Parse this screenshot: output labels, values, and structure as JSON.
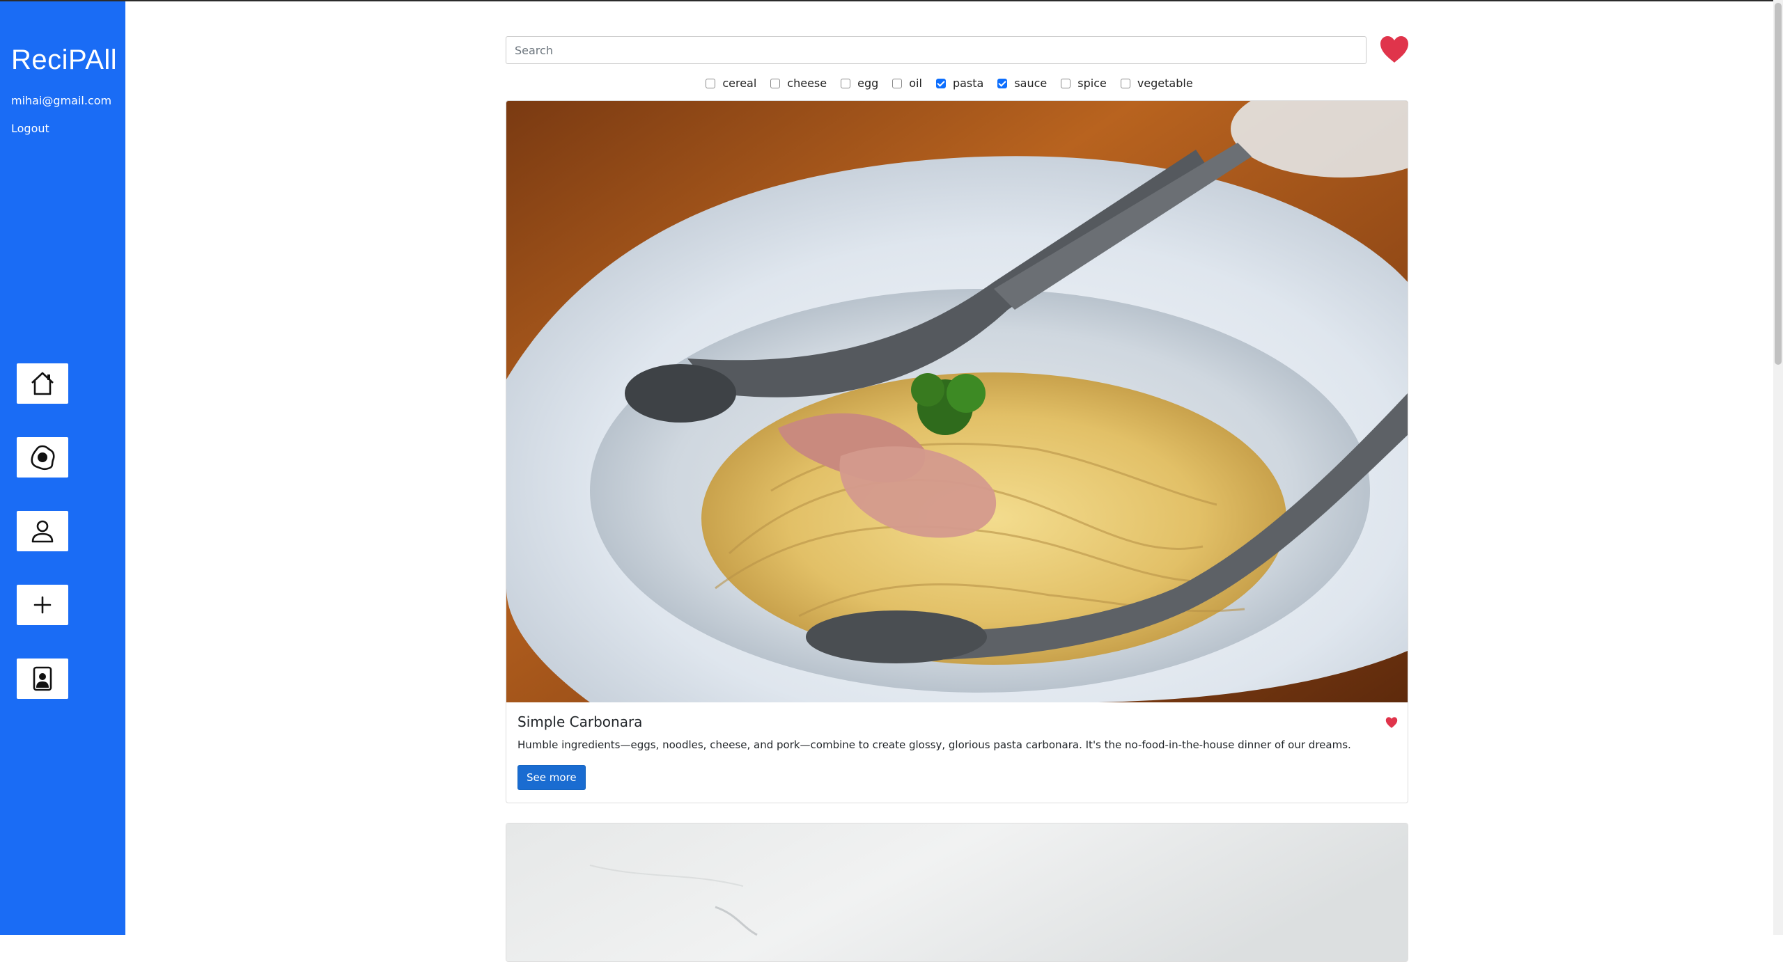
{
  "app": {
    "brand": "ReciPAll",
    "user_email": "mihai@gmail.com",
    "logout_label": "Logout"
  },
  "sidebar": {
    "nav": [
      {
        "icon": "home-icon"
      },
      {
        "icon": "egg-icon"
      },
      {
        "icon": "user-icon"
      },
      {
        "icon": "plus-icon"
      },
      {
        "icon": "contact-card-icon"
      }
    ]
  },
  "search": {
    "placeholder": "Search",
    "value": ""
  },
  "filters": [
    {
      "label": "cereal",
      "checked": false
    },
    {
      "label": "cheese",
      "checked": false
    },
    {
      "label": "egg",
      "checked": false
    },
    {
      "label": "oil",
      "checked": false
    },
    {
      "label": "pasta",
      "checked": true
    },
    {
      "label": "sauce",
      "checked": true
    },
    {
      "label": "spice",
      "checked": false
    },
    {
      "label": "vegetable",
      "checked": false
    }
  ],
  "recipes": [
    {
      "title": "Simple Carbonara",
      "description": "Humble ingredients—eggs, noodles, cheese, and pork—combine to create glossy, glorious pasta carbonara. It's the no-food-in-the-house dinner of our dreams.",
      "button_label": "See more",
      "favorited": true
    }
  ],
  "colors": {
    "sidebar": "#1a6cf5",
    "heart": "#e0344b",
    "button": "#1a6cd1",
    "checkbox": "#0d6efd"
  }
}
